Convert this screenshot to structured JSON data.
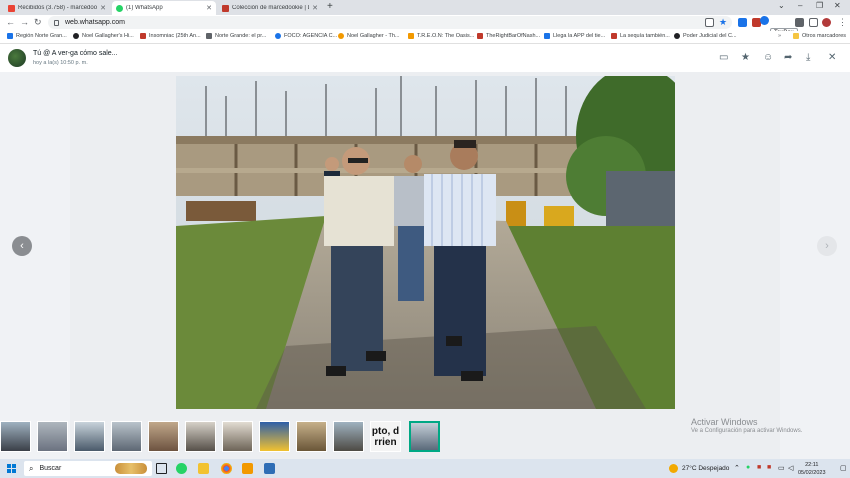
{
  "browser": {
    "tabs": [
      {
        "title": "Recibidos (3.758) - marcedookie",
        "favicon_color": "#ea4335",
        "active": false
      },
      {
        "title": "(1) WhatsApp",
        "favicon_color": "#25d366",
        "active": true
      },
      {
        "title": "Colección de marcedookie | Las",
        "favicon_color": "#c0392b",
        "active": false
      }
    ],
    "new_tab": "+",
    "url": "web.whatsapp.com",
    "tooltip": "TexBox",
    "bookmarks": [
      {
        "label": "Región Norte Gran...",
        "color": "#1a73e8"
      },
      {
        "label": "Noel Gallagher's Hi...",
        "color": "#202124"
      },
      {
        "label": "Insomniac (25th An...",
        "color": "#c0392b"
      },
      {
        "label": "Norte Grande: el pr...",
        "color": "#5f6368"
      },
      {
        "label": "FOCO: AGENCIA C...",
        "color": "#1a73e8"
      },
      {
        "label": "Noel Gallagher - Th...",
        "color": "#f29900"
      },
      {
        "label": "T.R.E.O.N: The Oasis...",
        "color": "#f29900"
      },
      {
        "label": "TheRightBarOfNash...",
        "color": "#c0392b"
      },
      {
        "label": "Llega la APP del tie...",
        "color": "#1a73e8"
      },
      {
        "label": "La sequía también...",
        "color": "#c0392b"
      },
      {
        "label": "Poder Judicial del C...",
        "color": "#202124"
      }
    ],
    "bookmarks_other": "Otros marcadores"
  },
  "viewer": {
    "sender": "Tú @ A ver-ga cómo sale...",
    "time": "hoy a la(s) 10:50 p. m."
  },
  "activate_windows": {
    "title": "Activar Windows",
    "subtitle": "Ve a Configuración para activar Windows."
  },
  "taskbar": {
    "search_placeholder": "Buscar",
    "weather": "27°C  Despejado",
    "time": "22:11",
    "date": "05/02/2023"
  },
  "colors": {
    "accent": "#0078d4",
    "whatsapp": "#25d366"
  }
}
